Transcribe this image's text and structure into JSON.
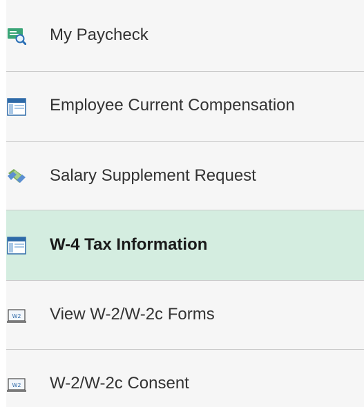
{
  "menu": {
    "items": [
      {
        "label": "My Paycheck",
        "icon": "paycheck-search-icon",
        "selected": false
      },
      {
        "label": "Employee Current Compensation",
        "icon": "page-window-icon",
        "selected": false
      },
      {
        "label": "Salary Supplement Request",
        "icon": "handshake-money-icon",
        "selected": false
      },
      {
        "label": "W-4 Tax Information",
        "icon": "page-window-icon",
        "selected": true
      },
      {
        "label": "View W-2/W-2c Forms",
        "icon": "w2-form-icon",
        "selected": false
      },
      {
        "label": "W-2/W-2c Consent",
        "icon": "w2-form-icon",
        "selected": false
      }
    ],
    "colors": {
      "background": "#f6f6f6",
      "selected_background": "#d4ede0",
      "divider": "#c9c9c9",
      "text": "#333333"
    }
  }
}
